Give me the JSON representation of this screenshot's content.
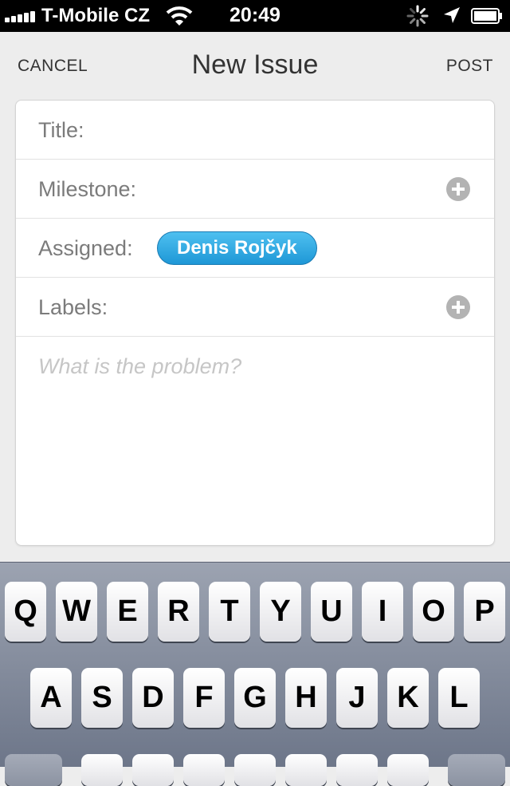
{
  "status_bar": {
    "carrier": "T-Mobile CZ",
    "time": "20:49",
    "signal_bars": 5,
    "icons": [
      "signal-icon",
      "wifi-icon",
      "activity-spinner-icon",
      "location-arrow-icon",
      "battery-icon"
    ]
  },
  "nav": {
    "cancel_label": "CANCEL",
    "title": "New Issue",
    "post_label": "POST"
  },
  "form": {
    "title_label": "Title:",
    "milestone_label": "Milestone:",
    "assigned_label": "Assigned:",
    "assignee": "Denis Rojčyk",
    "labels_label": "Labels:",
    "description_placeholder": "What is the problem?",
    "description_value": ""
  },
  "keyboard": {
    "row1": [
      "Q",
      "W",
      "E",
      "R",
      "T",
      "Y",
      "U",
      "I",
      "O",
      "P"
    ],
    "row2": [
      "A",
      "S",
      "D",
      "F",
      "G",
      "H",
      "J",
      "K",
      "L"
    ]
  },
  "colors": {
    "accent_pill": "#2aa6e2",
    "label_gray": "#7b7b7b",
    "status_bar": "#000000"
  }
}
